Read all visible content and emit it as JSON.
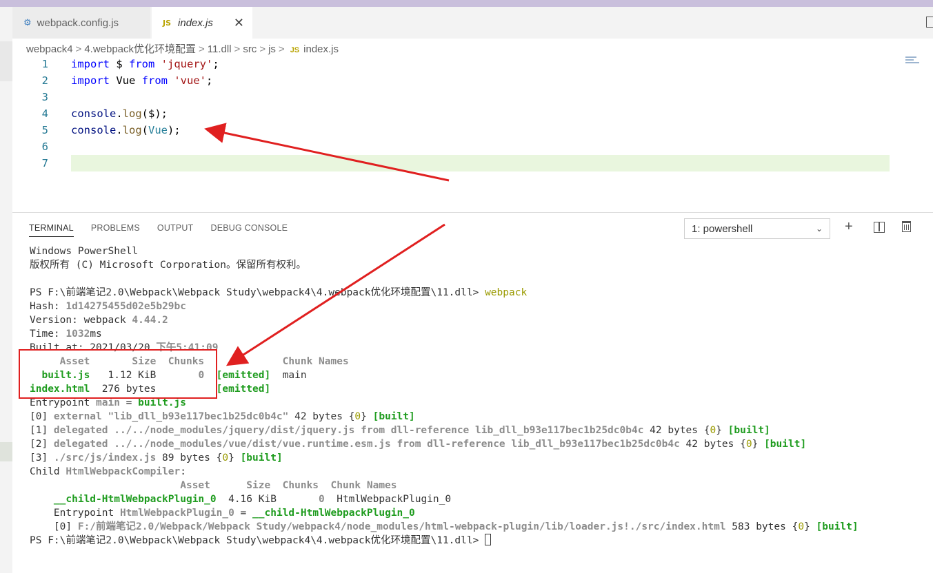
{
  "tabs": [
    {
      "label": "webpack.config.js",
      "icon": "gear-icon"
    },
    {
      "label": "index.js",
      "badge": "JS",
      "close": "✕"
    }
  ],
  "breadcrumb": {
    "items": [
      "webpack4",
      "4.webpack优化环境配置",
      "11.dll",
      "src",
      "js",
      "index.js"
    ],
    "badge": "JS"
  },
  "code": [
    {
      "n": "1",
      "tokens": [
        {
          "t": "import",
          "c": "kw"
        },
        {
          "t": " $ ",
          "c": "plain"
        },
        {
          "t": "from",
          "c": "kw"
        },
        {
          "t": " ",
          "c": "plain"
        },
        {
          "t": "'jquery'",
          "c": "str"
        },
        {
          "t": ";",
          "c": "plain"
        }
      ]
    },
    {
      "n": "2",
      "tokens": [
        {
          "t": "import",
          "c": "kw"
        },
        {
          "t": " Vue ",
          "c": "plain"
        },
        {
          "t": "from",
          "c": "kw"
        },
        {
          "t": " ",
          "c": "plain"
        },
        {
          "t": "'vue'",
          "c": "str"
        },
        {
          "t": ";",
          "c": "plain"
        }
      ]
    },
    {
      "n": "3",
      "tokens": []
    },
    {
      "n": "4",
      "tokens": [
        {
          "t": "console",
          "c": "var"
        },
        {
          "t": ".",
          "c": "plain"
        },
        {
          "t": "log",
          "c": "fn"
        },
        {
          "t": "($);",
          "c": "plain"
        }
      ]
    },
    {
      "n": "5",
      "tokens": [
        {
          "t": "console",
          "c": "var"
        },
        {
          "t": ".",
          "c": "plain"
        },
        {
          "t": "log",
          "c": "fn"
        },
        {
          "t": "(",
          "c": "plain"
        },
        {
          "t": "Vue",
          "c": "typ"
        },
        {
          "t": ");",
          "c": "plain"
        }
      ]
    },
    {
      "n": "6",
      "tokens": []
    },
    {
      "n": "7",
      "tokens": []
    }
  ],
  "panel": {
    "tabs": [
      "TERMINAL",
      "PROBLEMS",
      "OUTPUT",
      "DEBUG CONSOLE"
    ],
    "shell": "1: powershell",
    "add_icon": "+",
    "split_icon": "split-icon",
    "trash_icon": "trash-icon"
  },
  "terminal": [
    [
      {
        "t": "Windows PowerShell"
      }
    ],
    [
      {
        "t": "版权所有 (C) Microsoft Corporation。保留所有权利。"
      }
    ],
    [],
    [
      {
        "t": "PS F:\\前端笔记2.0\\Webpack\\Webpack Study\\webpack4\\4.webpack优化环境配置\\11.dll> "
      },
      {
        "t": "webpack",
        "c": "y"
      }
    ],
    [
      {
        "t": "Hash: "
      },
      {
        "t": "1d14275455d02e5b29bc",
        "c": "gy"
      }
    ],
    [
      {
        "t": "Version: webpack "
      },
      {
        "t": "4.44.2",
        "c": "gy"
      }
    ],
    [
      {
        "t": "Time: "
      },
      {
        "t": "1032",
        "c": "gy"
      },
      {
        "t": "ms"
      }
    ],
    [
      {
        "t": "Built at: 2021/03/20 "
      },
      {
        "t": "下午5:41:09",
        "c": "gy"
      }
    ],
    [
      {
        "t": "     Asset       Size  Chunks             ",
        "c": "gy"
      },
      {
        "t": "Chunk Names",
        "c": "gy"
      }
    ],
    [
      {
        "t": "  "
      },
      {
        "t": "built.js",
        "c": "g"
      },
      {
        "t": "   1.12 KiB       "
      },
      {
        "t": "0",
        "c": "gy"
      },
      {
        "t": "  "
      },
      {
        "t": "[emitted]",
        "c": "g"
      },
      {
        "t": "  main"
      }
    ],
    [
      {
        "t": "index.html",
        "c": "g"
      },
      {
        "t": "  276 bytes          "
      },
      {
        "t": "[emitted]",
        "c": "g"
      }
    ],
    [
      {
        "t": "Entrypoint "
      },
      {
        "t": "main",
        "c": "gy"
      },
      {
        "t": " = "
      },
      {
        "t": "built.js",
        "c": "g"
      }
    ],
    [
      {
        "t": "[0] "
      },
      {
        "t": "external \"lib_dll_b93e117bec1b25dc0b4c\"",
        "c": "gy"
      },
      {
        "t": " 42 bytes {"
      },
      {
        "t": "0",
        "c": "y"
      },
      {
        "t": "} "
      },
      {
        "t": "[built]",
        "c": "g"
      }
    ],
    [
      {
        "t": "[1] "
      },
      {
        "t": "delegated ../../node_modules/jquery/dist/jquery.js from dll-reference lib_dll_b93e117bec1b25dc0b4c",
        "c": "gy"
      },
      {
        "t": " 42 bytes {"
      },
      {
        "t": "0",
        "c": "y"
      },
      {
        "t": "} "
      },
      {
        "t": "[built]",
        "c": "g"
      }
    ],
    [
      {
        "t": "[2] "
      },
      {
        "t": "delegated ../../node_modules/vue/dist/vue.runtime.esm.js from dll-reference lib_dll_b93e117bec1b25dc0b4c",
        "c": "gy"
      },
      {
        "t": " 42 bytes {"
      },
      {
        "t": "0",
        "c": "y"
      },
      {
        "t": "} "
      },
      {
        "t": "[built]",
        "c": "g"
      }
    ],
    [
      {
        "t": "[3] "
      },
      {
        "t": "./src/js/index.js",
        "c": "gy"
      },
      {
        "t": " 89 bytes {"
      },
      {
        "t": "0",
        "c": "y"
      },
      {
        "t": "} "
      },
      {
        "t": "[built]",
        "c": "g"
      }
    ],
    [
      {
        "t": "Child "
      },
      {
        "t": "HtmlWebpackCompiler",
        "c": "gy"
      },
      {
        "t": ":"
      }
    ],
    [
      {
        "t": "                         Asset      Size  Chunks  Chunk Names",
        "c": "gy"
      }
    ],
    [
      {
        "t": "    "
      },
      {
        "t": "__child-HtmlWebpackPlugin_0",
        "c": "g"
      },
      {
        "t": "  4.16 KiB       "
      },
      {
        "t": "0",
        "c": "gy"
      },
      {
        "t": "  HtmlWebpackPlugin_0"
      }
    ],
    [
      {
        "t": "    Entrypoint "
      },
      {
        "t": "HtmlWebpackPlugin_0",
        "c": "gy"
      },
      {
        "t": " = "
      },
      {
        "t": "__child-HtmlWebpackPlugin_0",
        "c": "g"
      }
    ],
    [
      {
        "t": "    [0] "
      },
      {
        "t": "F:/前端笔记2.0/Webpack/Webpack Study/webpack4/node_modules/html-webpack-plugin/lib/loader.js!./src/index.html",
        "c": "gy"
      },
      {
        "t": " 583 bytes {"
      },
      {
        "t": "0",
        "c": "y"
      },
      {
        "t": "} "
      },
      {
        "t": "[built]",
        "c": "g"
      }
    ],
    [
      {
        "t": "PS F:\\前端笔记2.0\\Webpack\\Webpack Study\\webpack4\\4.webpack优化环境配置\\11.dll> "
      },
      {
        "t": "",
        "c": "cursor"
      }
    ]
  ],
  "colors": {
    "annotation": "#e02020",
    "current_line": "#e9f6de"
  }
}
